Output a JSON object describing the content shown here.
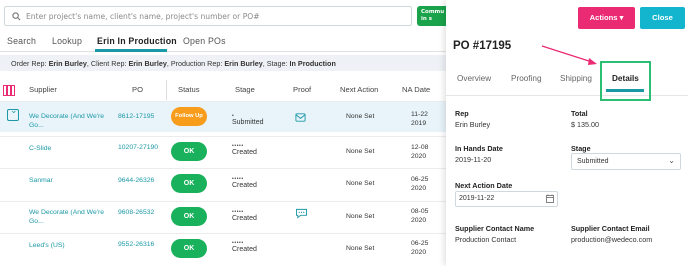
{
  "search": {
    "placeholder": "Enter project's name, client's name, project's number or PO#"
  },
  "community_button": {
    "line1": "Commu",
    "line2": "in s"
  },
  "tabs": [
    {
      "label": "Search"
    },
    {
      "label": "Lookup"
    },
    {
      "label": "Erin In Production"
    },
    {
      "label": "Open POs"
    }
  ],
  "filter": {
    "label1": "Order Rep: ",
    "value1": "Erin Burley",
    "label2": ", Client Rep: ",
    "value2": "Erin Burley",
    "label3": ", Production Rep: ",
    "value3": "Erin Burley",
    "label4": ", Stage: ",
    "value4": "In Production"
  },
  "columns": {
    "supplier": "Supplier",
    "po": "PO",
    "status": "Status",
    "stage": "Stage",
    "proof": "Proof",
    "next_action": "Next Action",
    "na_date": "NA Date"
  },
  "rows": [
    {
      "supplier_line1": "We Decorate (And We're",
      "supplier_line2": "Go...",
      "po": "8612-17195",
      "status": "Follow Up",
      "stage_dots": "•",
      "stage": "Submitted",
      "next_action": "None Set",
      "na_date_line1": "11-22",
      "na_date_line2": "2019"
    },
    {
      "supplier_line1": "C-Slide",
      "supplier_line2": "",
      "po": "10207-27190",
      "status": "OK",
      "stage_dots": "•••••",
      "stage": "Created",
      "next_action": "None Set",
      "na_date_line1": "12-08",
      "na_date_line2": "2020"
    },
    {
      "supplier_line1": "Sanmar",
      "supplier_line2": "",
      "po": "9644-26326",
      "status": "OK",
      "stage_dots": "•••••",
      "stage": "Created",
      "next_action": "None Set",
      "na_date_line1": "06-25",
      "na_date_line2": "2020"
    },
    {
      "supplier_line1": "We Decorate (And We're",
      "supplier_line2": "Go...",
      "po": "9608-26532",
      "status": "OK",
      "stage_dots": "•••••",
      "stage": "Created",
      "next_action": "None Set",
      "na_date_line1": "08-05",
      "na_date_line2": "2020"
    },
    {
      "supplier_line1": "Leed's (US)",
      "supplier_line2": "",
      "po": "9552-26316",
      "status": "OK",
      "stage_dots": "•••••",
      "stage": "Created",
      "next_action": "None Set",
      "na_date_line1": "06-25",
      "na_date_line2": "2020"
    }
  ],
  "panel": {
    "actions_label": "Actions ▾",
    "close_label": "Close",
    "po_title": "PO #17195",
    "tabs": [
      {
        "label": "Overview"
      },
      {
        "label": "Proofing"
      },
      {
        "label": "Shipping"
      },
      {
        "label": "Details"
      }
    ],
    "rep_label": "Rep",
    "rep_value": "Erin Burley",
    "total_label": "Total",
    "total_value": "$ 135.00",
    "in_hands_label": "In Hands Date",
    "in_hands_value": "2019-11-20",
    "stage_label": "Stage",
    "stage_value": "Submitted",
    "next_action_date_label": "Next Action Date",
    "next_action_date_value": "2019-11-22",
    "supplier_contact_name_label": "Supplier Contact Name",
    "supplier_contact_name_value": "Production Contact",
    "supplier_contact_email_label": "Supplier Contact Email",
    "supplier_contact_email_value": "production@wedeco.com"
  },
  "colors": {
    "accent": "#1b98a6",
    "ok_green": "#19b15b",
    "follow_up_orange": "#f79c1b",
    "actions_pink": "#ea2a72",
    "close_cyan": "#13b5ce",
    "highlight_box": "#2bbf73"
  }
}
